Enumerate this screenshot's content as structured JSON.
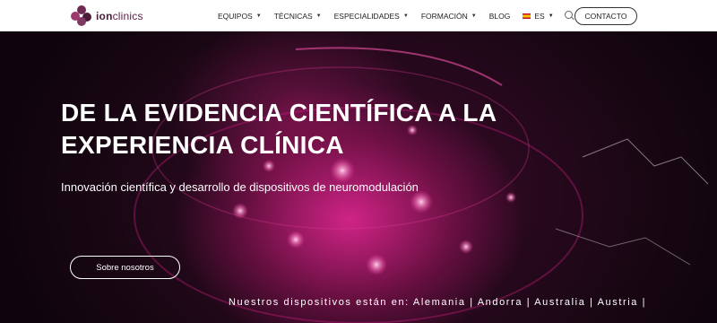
{
  "header": {
    "logo_text_bold": "ion",
    "logo_text": "clinics",
    "nav": [
      {
        "label": "EQUIPOS",
        "caret": "▼"
      },
      {
        "label": "TÉCNICAS",
        "caret": "▼"
      },
      {
        "label": "ESPECIALIDADES",
        "caret": "▼"
      },
      {
        "label": "FORMACIÓN",
        "caret": "▼"
      },
      {
        "label": "BLOG",
        "caret": ""
      }
    ],
    "language": {
      "label": "ES",
      "caret": "▼"
    },
    "contact_label": "CONTACTO"
  },
  "hero": {
    "title_line1": "DE LA EVIDENCIA CIENTÍFICA A LA",
    "title_line2": "EXPERIENCIA CLÍNICA",
    "subtitle": "Innovación científica y desarrollo de dispositivos de neuromodulación",
    "button_label": "Sobre nosotros",
    "countries_text": "Nuestros dispositivos están en: Alemania | Andorra | Australia | Austria |"
  },
  "colors": {
    "accent": "#e0288f",
    "brand": "#5a2346",
    "background_dark": "#1a0612"
  }
}
